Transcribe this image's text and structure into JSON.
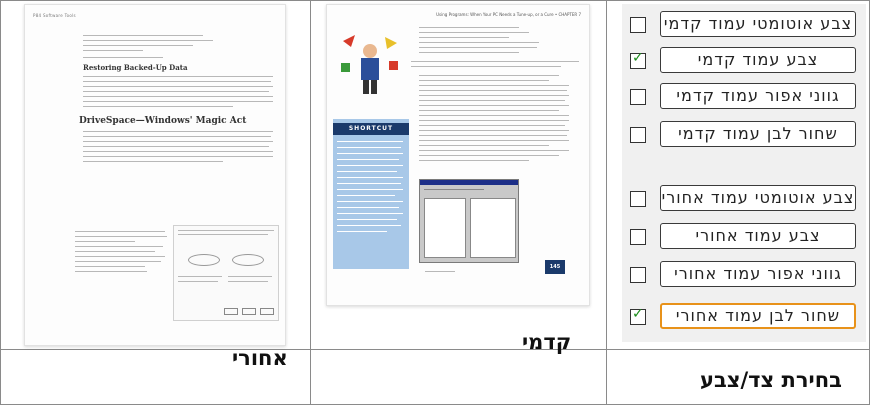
{
  "captions": {
    "back": "אחורי",
    "front": "קדמי",
    "panel": "בחירת צד/צבע"
  },
  "back_page": {
    "header": "P84 Software Tools",
    "heading1": "Restoring Backed-Up Data",
    "heading2": "DriveSpace—Windows' Magic Act"
  },
  "front_page": {
    "header": "Using Programs: When Your PC Needs a Tune-up, or a Cure • CHAPTER 7",
    "shortcut_label": "SHORTCUT",
    "page_number": "145"
  },
  "options": [
    {
      "label": "צבע אוטומטי עמוד קדמי",
      "checked": false,
      "selected": false
    },
    {
      "label": "צבע עמוד קדמי",
      "checked": true,
      "selected": false
    },
    {
      "label": "גווני אפור עמוד קדמי",
      "checked": false,
      "selected": false
    },
    {
      "label": "שחור לבן עמוד קדמי",
      "checked": false,
      "selected": false
    },
    {
      "label": "צבע אוטומטי עמוד אחורי",
      "checked": false,
      "selected": false
    },
    {
      "label": "צבע עמוד אחורי",
      "checked": false,
      "selected": false
    },
    {
      "label": "גווני אפור עמוד אחורי",
      "checked": false,
      "selected": false
    },
    {
      "label": "שחור לבן עמוד אחורי",
      "checked": true,
      "selected": true
    }
  ],
  "colors": {
    "selected_border": "#e8921a",
    "check_mark": "#1a8c1a",
    "shortcut_bar": "#1b3a6b",
    "shortcut_box": "#a8c8e8"
  }
}
